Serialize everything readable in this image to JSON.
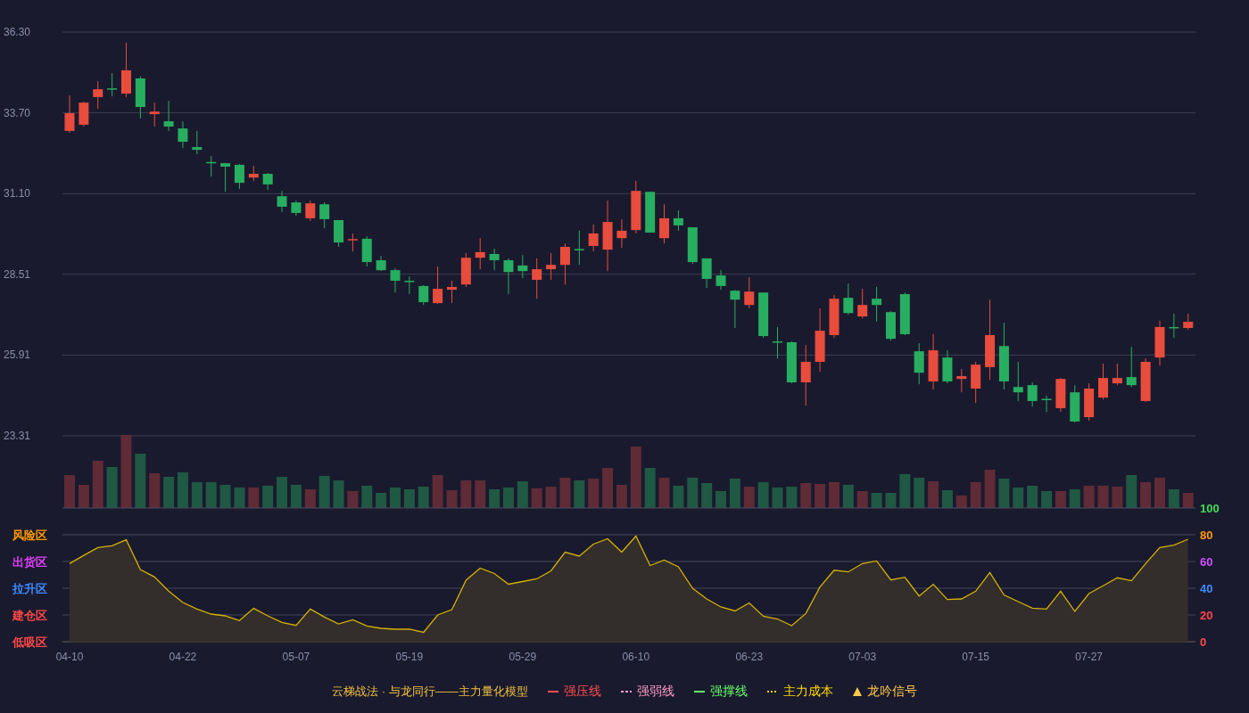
{
  "price_chart": {
    "chart_data": {
      "type": "candlestick",
      "grid": true,
      "ylim": [
        23.31,
        36.3
      ],
      "yticks": [
        {
          "value": 36.3,
          "label": "36.30"
        },
        {
          "value": 33.7,
          "label": "33.70"
        },
        {
          "value": 31.1,
          "label": "31.10"
        },
        {
          "value": 28.51,
          "label": "28.51"
        },
        {
          "value": 25.91,
          "label": "25.91"
        },
        {
          "value": 23.31,
          "label": "23.31"
        }
      ],
      "ohlc": [
        [
          33.12,
          34.26,
          33.06,
          33.69
        ],
        [
          33.32,
          34.06,
          33.26,
          34.03
        ],
        [
          34.21,
          34.72,
          33.83,
          34.46
        ],
        [
          34.49,
          34.98,
          34.23,
          34.46
        ],
        [
          34.32,
          35.96,
          34.21,
          35.07
        ],
        [
          34.81,
          34.87,
          33.52,
          33.89
        ],
        [
          33.66,
          34.03,
          33.26,
          33.74
        ],
        [
          33.43,
          34.09,
          33.12,
          33.26
        ],
        [
          33.2,
          33.43,
          32.57,
          32.77
        ],
        [
          32.6,
          33.12,
          32.37,
          32.51
        ],
        [
          32.12,
          32.31,
          31.65,
          32.11
        ],
        [
          32.08,
          32.09,
          31.16,
          31.97
        ],
        [
          32.03,
          32.06,
          31.25,
          31.45
        ],
        [
          31.62,
          32.0,
          31.51,
          31.74
        ],
        [
          31.74,
          31.77,
          31.22,
          31.4
        ],
        [
          31.02,
          31.19,
          30.51,
          30.68
        ],
        [
          30.82,
          30.88,
          30.39,
          30.48
        ],
        [
          30.31,
          30.88,
          30.22,
          30.79
        ],
        [
          30.76,
          30.82,
          29.99,
          30.28
        ],
        [
          30.25,
          30.25,
          29.39,
          29.53
        ],
        [
          29.6,
          29.82,
          29.24,
          29.64
        ],
        [
          29.65,
          29.73,
          28.76,
          28.9
        ],
        [
          28.96,
          29.1,
          28.61,
          28.64
        ],
        [
          28.64,
          28.7,
          27.92,
          28.3
        ],
        [
          28.3,
          28.44,
          27.87,
          28.27
        ],
        [
          28.13,
          28.16,
          27.52,
          27.61
        ],
        [
          27.58,
          28.76,
          27.55,
          28.04
        ],
        [
          28.01,
          28.3,
          27.58,
          28.1
        ],
        [
          28.18,
          29.19,
          28.1,
          29.04
        ],
        [
          29.04,
          29.67,
          28.67,
          29.22
        ],
        [
          29.16,
          29.33,
          28.64,
          28.96
        ],
        [
          28.96,
          29.02,
          27.87,
          28.58
        ],
        [
          28.79,
          29.13,
          28.38,
          28.61
        ],
        [
          28.33,
          29.02,
          27.72,
          28.67
        ],
        [
          28.67,
          29.19,
          28.33,
          28.81
        ],
        [
          28.81,
          29.5,
          28.18,
          29.39
        ],
        [
          29.32,
          29.91,
          28.81,
          29.3
        ],
        [
          29.42,
          30.11,
          29.24,
          29.82
        ],
        [
          29.3,
          30.88,
          28.61,
          30.19
        ],
        [
          29.67,
          30.28,
          29.36,
          29.91
        ],
        [
          29.93,
          31.51,
          29.82,
          31.19
        ],
        [
          31.16,
          31.16,
          29.85,
          29.85
        ],
        [
          29.67,
          30.76,
          29.5,
          30.31
        ],
        [
          30.31,
          30.56,
          29.91,
          30.08
        ],
        [
          30.02,
          30.02,
          28.84,
          28.9
        ],
        [
          29.02,
          29.02,
          28.07,
          28.36
        ],
        [
          28.47,
          28.64,
          28.01,
          28.13
        ],
        [
          27.98,
          28.01,
          26.78,
          27.69
        ],
        [
          27.52,
          28.41,
          27.41,
          27.95
        ],
        [
          27.92,
          27.92,
          26.46,
          26.52
        ],
        [
          26.35,
          26.81,
          25.8,
          26.32
        ],
        [
          26.32,
          26.35,
          25.0,
          25.03
        ],
        [
          25.03,
          26.23,
          24.28,
          25.69
        ],
        [
          25.69,
          27.41,
          25.37,
          26.69
        ],
        [
          26.55,
          27.84,
          26.46,
          27.72
        ],
        [
          27.75,
          28.21,
          27.21,
          27.26
        ],
        [
          27.15,
          28.04,
          27.09,
          27.52
        ],
        [
          27.72,
          28.1,
          26.99,
          27.52
        ],
        [
          27.29,
          27.32,
          26.37,
          26.43
        ],
        [
          27.87,
          27.92,
          26.55,
          26.58
        ],
        [
          26.03,
          26.29,
          24.97,
          25.34
        ],
        [
          25.06,
          26.58,
          24.8,
          26.06
        ],
        [
          25.83,
          26.06,
          25.0,
          25.06
        ],
        [
          25.14,
          25.46,
          24.71,
          25.23
        ],
        [
          24.83,
          25.69,
          24.37,
          25.6
        ],
        [
          25.52,
          27.69,
          25.11,
          26.55
        ],
        [
          26.2,
          26.95,
          24.8,
          25.06
        ],
        [
          24.88,
          25.69,
          24.43,
          24.71
        ],
        [
          24.94,
          25.03,
          24.25,
          24.43
        ],
        [
          24.5,
          24.6,
          24.08,
          24.48
        ],
        [
          24.2,
          25.17,
          24.08,
          25.14
        ],
        [
          24.71,
          24.94,
          23.74,
          23.77
        ],
        [
          23.91,
          25.0,
          23.8,
          24.83
        ],
        [
          24.54,
          25.63,
          24.48,
          25.17
        ],
        [
          25.0,
          25.63,
          24.94,
          25.17
        ],
        [
          25.2,
          26.17,
          24.88,
          24.94
        ],
        [
          24.43,
          25.8,
          24.4,
          25.69
        ],
        [
          25.83,
          27.01,
          25.57,
          26.81
        ],
        [
          26.81,
          27.24,
          26.46,
          26.78
        ],
        [
          26.78,
          27.24,
          26.72,
          26.98
        ]
      ]
    }
  },
  "oscillator": {
    "zones": [
      {
        "label": "风险区",
        "color": "#ff9900"
      },
      {
        "label": "出货区",
        "color": "#e040fb"
      },
      {
        "label": "拉升区",
        "color": "#3d8bff"
      },
      {
        "label": "建仓区",
        "color": "#ff4848"
      },
      {
        "label": "低吸区",
        "color": "#ff4848"
      }
    ],
    "tick_colors": [
      {
        "color": "#44dd55"
      },
      {
        "color": "#ff9900"
      },
      {
        "color": "#d050ff"
      },
      {
        "color": "#3d8bff"
      },
      {
        "color": "#ff4848"
      },
      {
        "color": "#ff4848"
      }
    ],
    "dates": [
      "04-10",
      "04-22",
      "05-07",
      "05-19",
      "05-29",
      "06-10",
      "06-23",
      "07-03",
      "07-15",
      "07-27"
    ],
    "chart_data": {
      "type": "area",
      "grid": true,
      "ylim": [
        0,
        100
      ],
      "yticks": [
        {
          "value": 100,
          "label": "100"
        },
        {
          "value": 80,
          "label": "80"
        },
        {
          "value": 60,
          "label": "60"
        },
        {
          "value": 40,
          "label": "40"
        },
        {
          "value": 20,
          "label": "20"
        },
        {
          "value": 0,
          "label": "0"
        }
      ],
      "values": [
        58.4,
        64.6,
        70.4,
        71.8,
        76.2,
        54,
        48.4,
        37.8,
        29.3,
        24.4,
        20.7,
        19.3,
        15.8,
        24.9,
        19.3,
        14.4,
        12.2,
        24.4,
        18.4,
        13.3,
        16.4,
        11.8,
        10,
        9.3,
        9.5,
        7,
        20,
        24,
        46,
        55,
        51,
        43,
        45,
        47,
        53,
        67,
        64,
        73,
        77,
        67,
        79,
        57,
        61,
        56,
        40,
        32,
        26,
        23,
        29,
        19,
        17,
        12,
        21.1,
        40.9,
        53.5,
        52.2,
        58.5,
        60.4,
        46.2,
        48.2,
        34.2,
        42.9,
        31.6,
        32,
        37.8,
        51.8,
        34.9,
        30,
        25.1,
        24.4,
        37.8,
        22.7,
        36,
        41.8,
        47.8,
        45.6,
        58.5,
        70.4,
        72.2,
        76.7
      ]
    }
  },
  "legend": {
    "title": "云梯战法 · 与龙同行——主力量化模型",
    "items": [
      {
        "label": "强压线",
        "color": "#ff4d4d",
        "kind": "solid"
      },
      {
        "label": "强弱线",
        "color": "#ff9ec8",
        "kind": "dashed"
      },
      {
        "label": "强撑线",
        "color": "#66ff66",
        "kind": "solid"
      },
      {
        "label": "主力成本",
        "color": "#ffd700",
        "kind": "dotted"
      },
      {
        "label": "龙吟信号",
        "color": "#ffc94a",
        "kind": "triangle"
      }
    ]
  }
}
